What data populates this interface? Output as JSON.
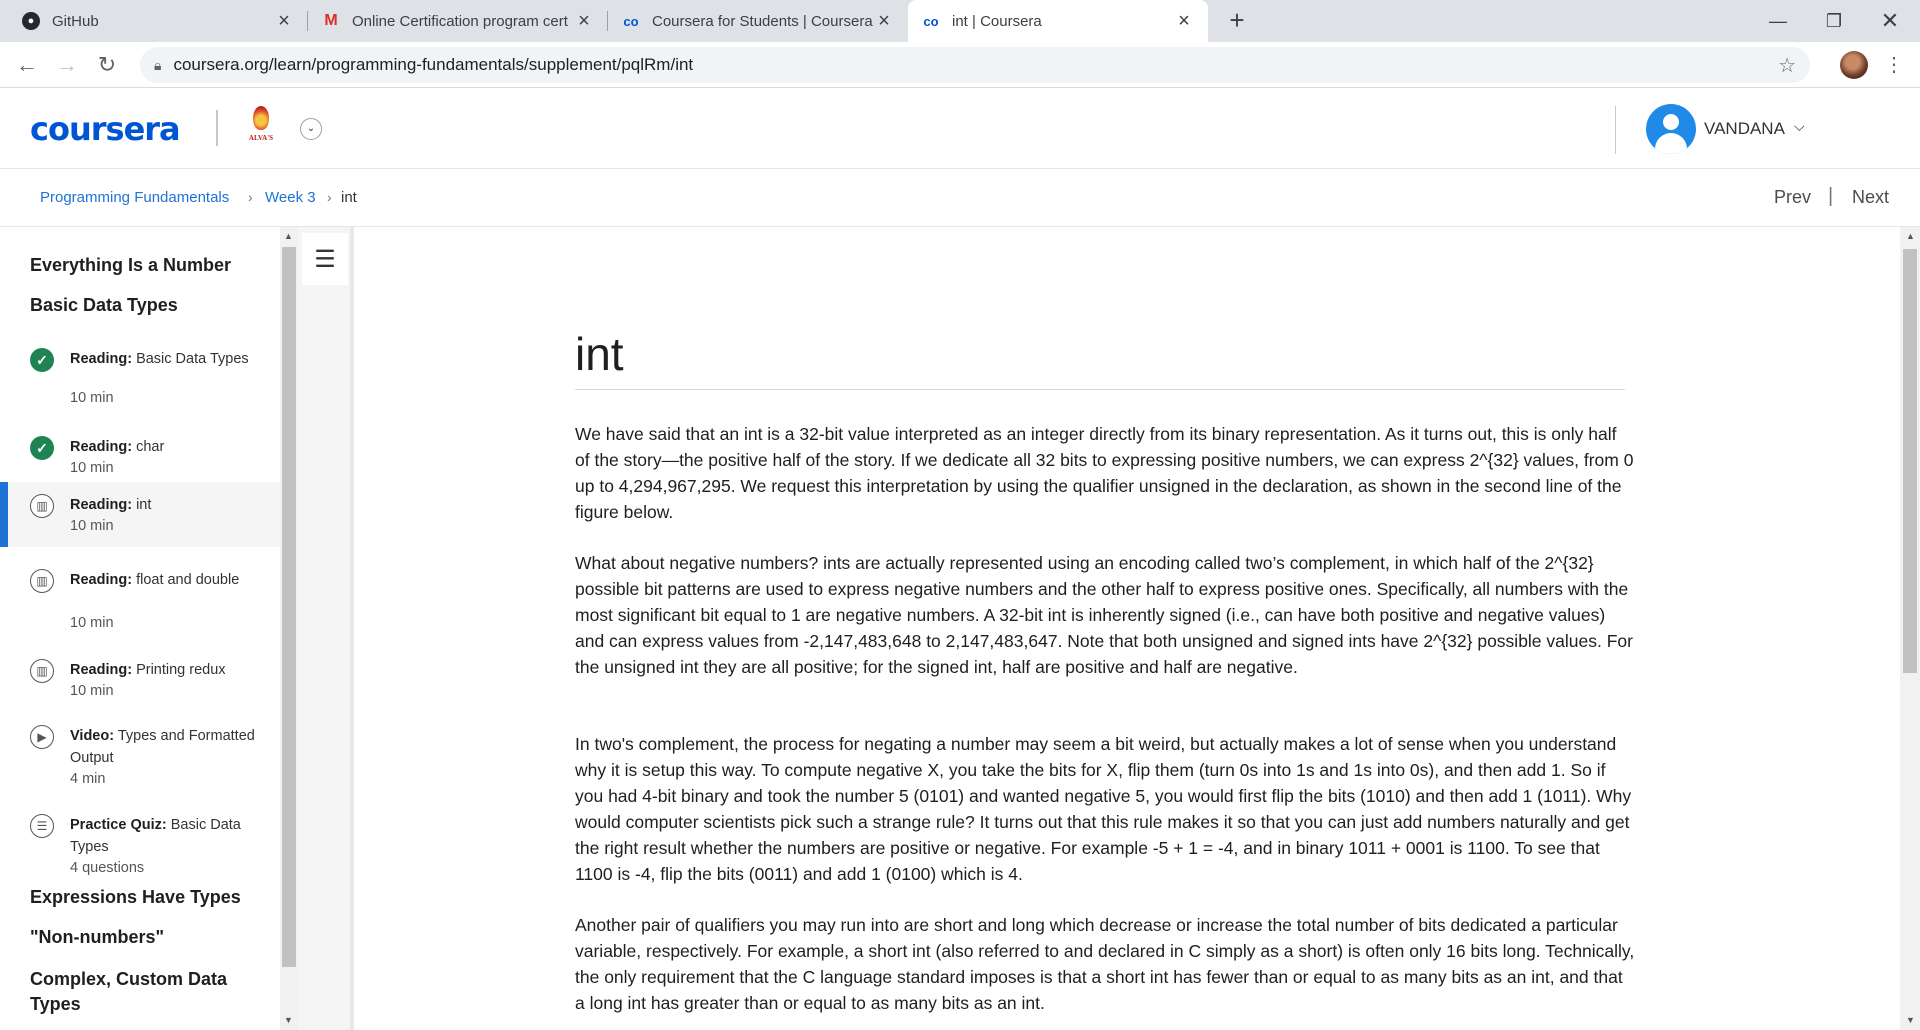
{
  "browser": {
    "tabs": [
      {
        "title": "GitHub",
        "icon": "github-icon",
        "active": false
      },
      {
        "title": "Online Certification program cert",
        "icon": "gmail-icon",
        "active": false
      },
      {
        "title": "Coursera for Students | Coursera",
        "icon": "coursera-icon",
        "active": false
      },
      {
        "title": "int | Coursera",
        "icon": "coursera-icon",
        "active": true
      }
    ],
    "url": "coursera.org/learn/programming-fundamentals/supplement/pqlRm/int"
  },
  "header": {
    "logo": "coursera",
    "partner_text": "ALVA'S",
    "user_name": "VANDANA"
  },
  "breadcrumb": {
    "course": "Programming Fundamentals",
    "week": "Week 3",
    "current": "int",
    "prev": "Prev",
    "next": "Next",
    "separator": "|"
  },
  "sidebar": {
    "section1": "Everything Is a Number",
    "section2": "Basic Data Types",
    "items": [
      {
        "type": "Reading:",
        "title": "Basic Data Types",
        "meta": "10 min",
        "status": "done"
      },
      {
        "type": "Reading:",
        "title": "char",
        "meta": "10 min",
        "status": "done"
      },
      {
        "type": "Reading:",
        "title": "int",
        "meta": "10 min",
        "status": "active"
      },
      {
        "type": "Reading:",
        "title": "float and double",
        "meta": "10 min",
        "status": "reading"
      },
      {
        "type": "Reading:",
        "title": "Printing redux",
        "meta": "10 min",
        "status": "reading"
      },
      {
        "type": "Video:",
        "title": "Types and Formatted Output",
        "meta": "4 min",
        "status": "video"
      },
      {
        "type": "Practice Quiz:",
        "title": "Basic Data Types",
        "meta": "4 questions",
        "status": "quiz"
      }
    ],
    "section3": "Expressions Have Types",
    "section4": "\"Non-numbers\"",
    "section5": "Complex, Custom Data Types"
  },
  "content": {
    "title": "int",
    "paragraphs": [
      "We have said that an int is a 32-bit value interpreted as an integer directly from its binary representation. As it turns out, this is only half of the story—the positive half of the story. If we dedicate all 32 bits to expressing positive numbers, we can express 2^{32} values, from 0 up to 4,294,967,295. We request this interpretation by using the qualifier unsigned in the declaration, as shown in the second line of the figure below.",
      "What about negative numbers? ints are actually represented using an encoding called two’s complement, in which half of the 2^{32} possible bit patterns are used to express negative numbers and the other half to express positive ones. Specifically, all numbers with the most significant bit equal to 1 are negative numbers. A 32-bit int is inherently signed (i.e., can have both positive and negative values) and can express values from -2,147,483,648 to 2,147,483,647. Note that both unsigned and signed ints have 2^{32} possible values. For the unsigned int they are all positive; for the signed int, half are positive and half are negative.",
      "In two's complement, the process for negating a number may seem a bit weird, but actually makes a lot of sense when you understand why it is setup this way. To compute negative X, you take the bits for X, flip them (turn 0s into 1s and 1s into 0s), and then add 1. So if you had 4-bit binary and took the number 5 (0101) and wanted negative 5, you would first flip the bits (1010) and then add 1 (1011). Why would computer scientists pick such a strange rule? It turns out that this rule makes it so that you can just add numbers naturally and get the right result whether the numbers are positive or negative. For example -5 + 1 = -4, and in binary 1011 + 0001 is 1100. To see that 1100 is -4, flip the bits (0011) and add 1 (0100) which is 4.",
      "Another pair of qualifiers you may run into are short and long which decrease or increase the total number of bits dedicated a particular variable, respectively. For example, a short int (also referred to and declared in C simply as a short) is often only 16 bits long. Technically, the only requirement that the C language standard imposes is that a short int has fewer than or equal to as many bits as an int, and that a long int has greater than or equal to as many bits as an int."
    ]
  },
  "colors": {
    "brand": "#0056d2",
    "link": "#1f73d6",
    "done": "#1f8354"
  }
}
